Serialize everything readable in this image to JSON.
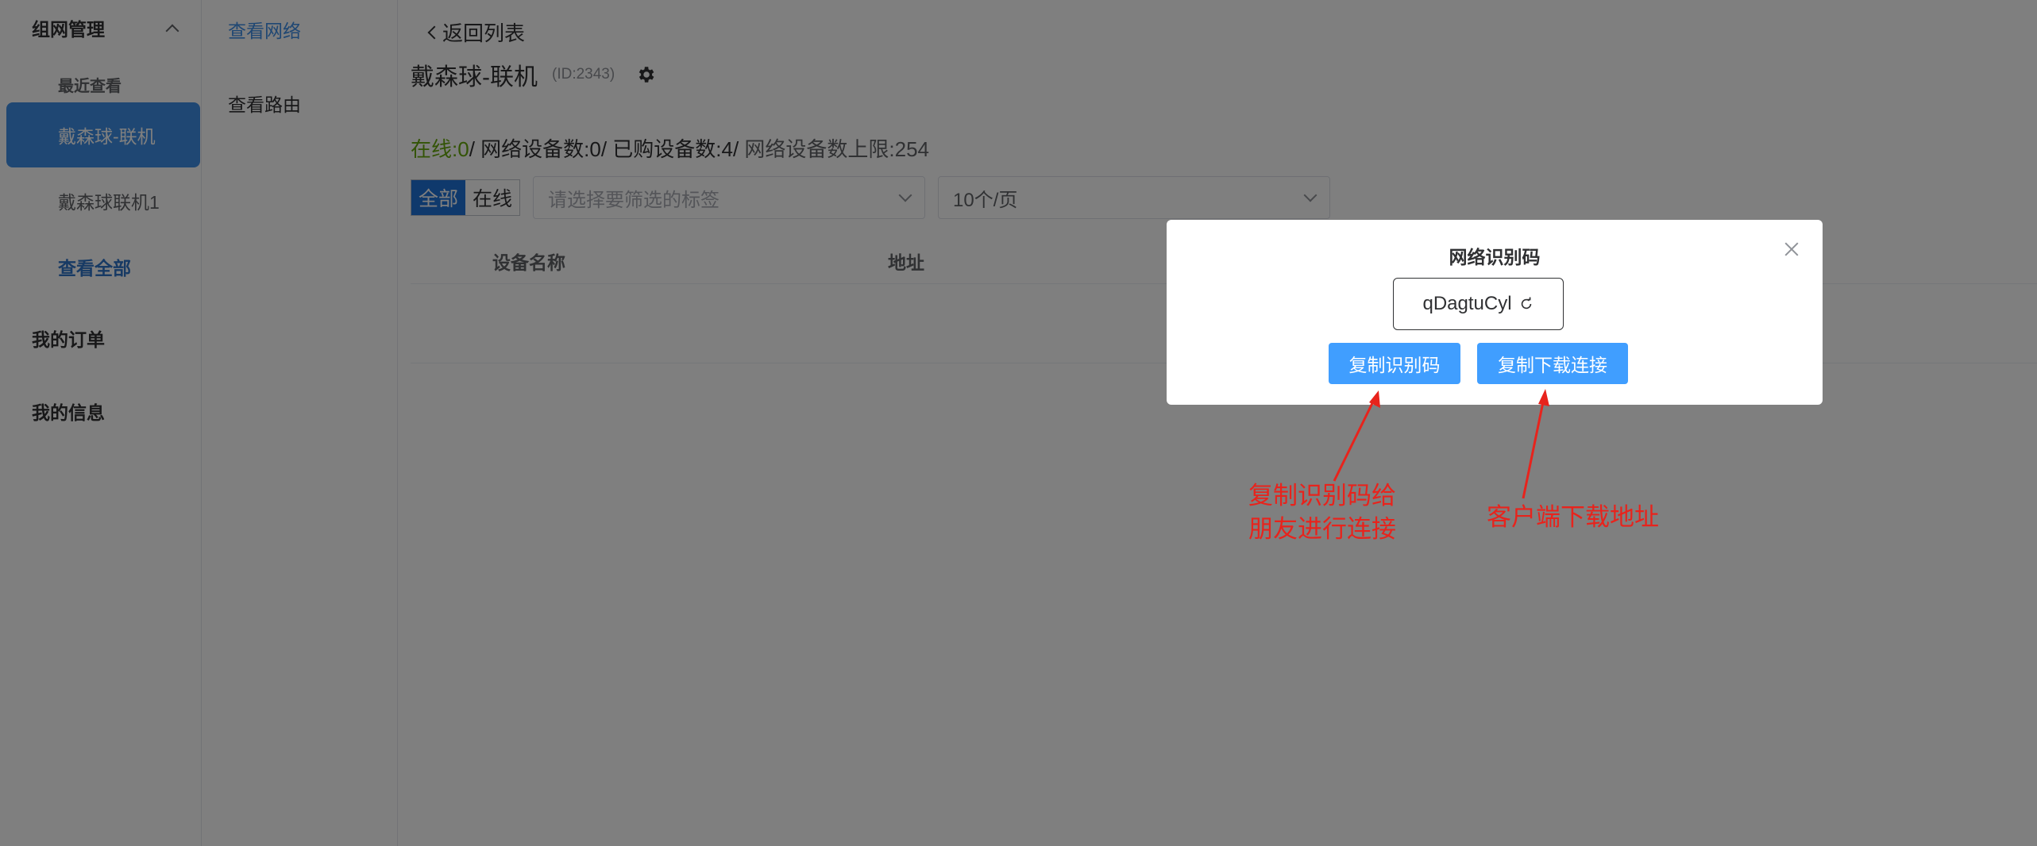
{
  "sidebar": {
    "group_title": "组网管理",
    "recent_title": "最近查看",
    "items": [
      {
        "label": "戴森球-联机"
      },
      {
        "label": "戴森球联机1"
      },
      {
        "label": "查看全部"
      }
    ],
    "orders": "我的订单",
    "info": "我的信息"
  },
  "subnav": {
    "items": [
      {
        "label": "查看网络"
      },
      {
        "label": "查看路由"
      }
    ]
  },
  "main": {
    "back_label": "返回列表",
    "title": "戴森球-联机",
    "id_text": "(ID:2343)",
    "stats": {
      "online": "在线:0",
      "devices": "/ 网络设备数:0/ 已购设备数:4/",
      "limit": " 网络设备数上限:254"
    },
    "filter": {
      "seg_all": "全部",
      "seg_online": "在线",
      "tag_placeholder": "请选择要筛选的标签",
      "page_size": "10个/页"
    },
    "table": {
      "columns": [
        "设备名称",
        "地址"
      ]
    }
  },
  "dialog": {
    "title": "网络识别码",
    "code": "qDagtuCyl",
    "copy_code_btn": "复制识别码",
    "copy_link_btn": "复制下载连接"
  },
  "annotations": {
    "left_line1": "复制识别码给",
    "left_line2": "朋友进行连接",
    "right": "客户端下载地址"
  },
  "colors": {
    "accent": "#409eff",
    "active_menu": "#3f8fe7",
    "online_green": "#67a80c",
    "annotation_red": "#e8231c"
  }
}
